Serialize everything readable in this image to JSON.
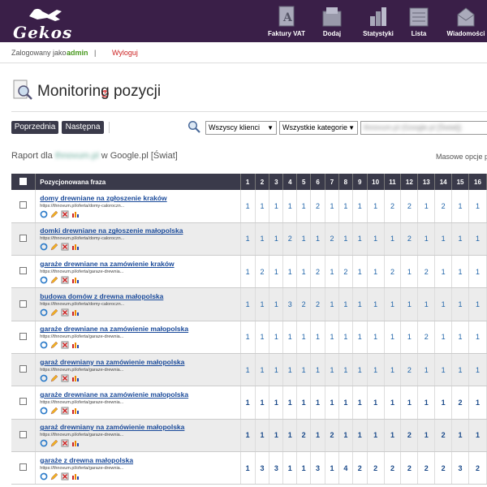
{
  "app": {
    "logo": "Gekos"
  },
  "nav": [
    {
      "label": "Faktury VAT",
      "icon": "invoice-icon"
    },
    {
      "label": "Dodaj",
      "icon": "add-icon"
    },
    {
      "label": "Statystyki",
      "icon": "stats-icon"
    },
    {
      "label": "Lista",
      "icon": "list-icon"
    },
    {
      "label": "Wiadomości",
      "icon": "mail-icon"
    }
  ],
  "subbar": {
    "logged_label": "Zalogowany jako :",
    "user": "admin",
    "separator": "|",
    "logout": "Wyloguj"
  },
  "page": {
    "title": "Monitoring pozycji"
  },
  "toolbar": {
    "prev": "Poprzednia",
    "next": "Następna",
    "clients_select": "Wszyscy klienci",
    "category_select": "Wszystkie kategorie",
    "site_select": "thnovum.pl (Google.pl [Świat])"
  },
  "report": {
    "prefix": "Raport dla",
    "domain": "thnovum.pl",
    "suffix": "w Google.pl [Świat]",
    "bulk_options": "Masowe opcje p"
  },
  "table": {
    "phrase_header": "Pozycjonowana fraza",
    "columns": [
      "1",
      "2",
      "3",
      "4",
      "5",
      "6",
      "7",
      "8",
      "9",
      "10",
      "11",
      "12",
      "13",
      "14",
      "15",
      "16"
    ],
    "rows": [
      {
        "phrase": "domy drewniane na zgłoszenie kraków",
        "url": "https://thnovum.pl/oferta/domy-caloroczn...",
        "bold": false,
        "values": [
          "1",
          "1",
          "1",
          "1",
          "1",
          "2",
          "1",
          "1",
          "1",
          "1",
          "2",
          "2",
          "1",
          "2",
          "1",
          "1"
        ]
      },
      {
        "phrase": "domki drewniane na zgłoszenie małopolska",
        "url": "https://thnovum.pl/oferta/domy-caloroczn...",
        "bold": false,
        "values": [
          "1",
          "1",
          "1",
          "2",
          "1",
          "1",
          "2",
          "1",
          "1",
          "1",
          "1",
          "2",
          "1",
          "1",
          "1",
          "1"
        ]
      },
      {
        "phrase": "garaże drewniane na zamówienie kraków",
        "url": "https://thnovum.pl/oferta/garaze-drewnia...",
        "bold": false,
        "values": [
          "1",
          "2",
          "1",
          "1",
          "1",
          "2",
          "1",
          "2",
          "1",
          "1",
          "2",
          "1",
          "2",
          "1",
          "1",
          "1"
        ]
      },
      {
        "phrase": "budowa domów z drewna małopolska",
        "url": "https://thnovum.pl/oferta/domy-caloroczn...",
        "bold": false,
        "values": [
          "1",
          "1",
          "1",
          "3",
          "2",
          "2",
          "1",
          "1",
          "1",
          "1",
          "1",
          "1",
          "1",
          "1",
          "1",
          "1"
        ]
      },
      {
        "phrase": "garaże drewniane na zamówienie małopolska",
        "url": "https://thnovum.pl/oferta/garaze-drewnia...",
        "bold": false,
        "values": [
          "1",
          "1",
          "1",
          "1",
          "1",
          "1",
          "1",
          "1",
          "1",
          "1",
          "1",
          "1",
          "2",
          "1",
          "1",
          "1"
        ]
      },
      {
        "phrase": "garaż drewniany na zamówienie małopolska",
        "url": "https://thnovum.pl/oferta/garaze-drewnia...",
        "bold": false,
        "values": [
          "1",
          "1",
          "1",
          "1",
          "1",
          "1",
          "1",
          "1",
          "1",
          "1",
          "1",
          "2",
          "1",
          "1",
          "1",
          "1"
        ]
      },
      {
        "phrase": "garaże drewniane na zamówienie małopolska",
        "url": "https://thnovum.pl/oferta/garaze-drewnia...",
        "bold": true,
        "values": [
          "1",
          "1",
          "1",
          "1",
          "1",
          "1",
          "1",
          "1",
          "1",
          "1",
          "1",
          "1",
          "1",
          "1",
          "2",
          "1"
        ]
      },
      {
        "phrase": "garaż drewniany na zamówienie małopolska",
        "url": "https://thnovum.pl/oferta/garaze-drewnia...",
        "bold": true,
        "values": [
          "1",
          "1",
          "1",
          "1",
          "2",
          "1",
          "2",
          "1",
          "1",
          "1",
          "1",
          "2",
          "1",
          "2",
          "1",
          "1"
        ]
      },
      {
        "phrase": "garaże z drewna małopolska",
        "url": "https://thnovum.pl/oferta/garaze-drewnia...",
        "bold": true,
        "values": [
          "1",
          "3",
          "3",
          "1",
          "1",
          "3",
          "1",
          "4",
          "2",
          "2",
          "2",
          "2",
          "2",
          "2",
          "3",
          "2"
        ]
      }
    ]
  }
}
